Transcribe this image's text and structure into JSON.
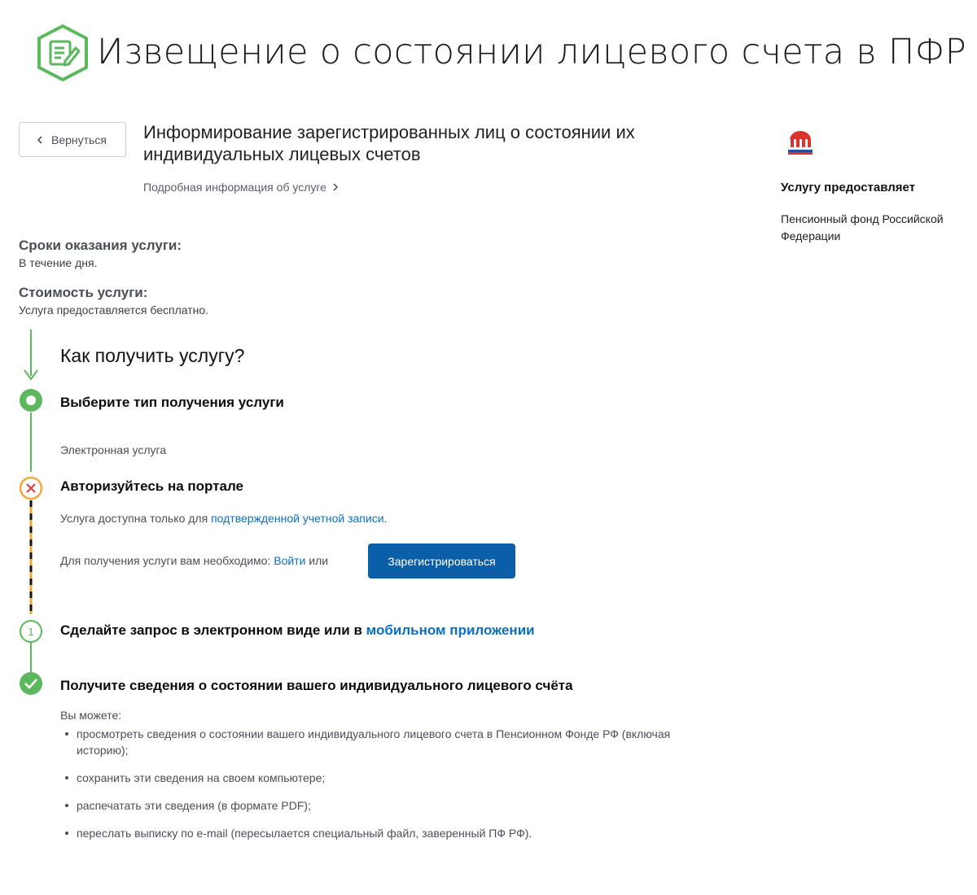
{
  "header": {
    "title": "Извещение о состоянии лицевого счета в ПФР",
    "icon": "document-edit-icon",
    "accent": "#5cb85c"
  },
  "service": {
    "back_label": "Вернуться",
    "title_bold": "Информирование зарегистрированных лиц о состоянии их индивидуальных лицевых счетов",
    "more_info": "Подробная информация об услуге"
  },
  "provider": {
    "heading": "Услугу предоставляет",
    "name": "Пенсионный фонд Российской Федерации",
    "logo": "pfr-logo-icon"
  },
  "meta": {
    "term_label": "Сроки оказания услуги:",
    "term_value": "В течение дня.",
    "cost_label": "Стоимость услуги:",
    "cost_value": "Услуга предоставляется бесплатно."
  },
  "how": {
    "title": "Как получить услугу?",
    "step1": {
      "title": "Выберите тип получения услуги",
      "value": "Электронная услуга"
    },
    "step2": {
      "title": "Авторизуйтесь на портале",
      "text_prefix": "Услуга доступна только для ",
      "text_link": "подтвержденной учетной записи",
      "text_suffix": ".",
      "need_prefix": "Для получения услуги вам необходимо: ",
      "login_link": "Войти",
      "need_or": " или",
      "register_button": "Зарегистрироваться"
    },
    "step3": {
      "number": "1",
      "title_prefix": "Сделайте запрос в электронном виде или в ",
      "title_link": "мобильном приложении"
    },
    "step4": {
      "title": "Получите сведения о состоянии вашего индивидуального лицевого счёта",
      "intro": "Вы можете:",
      "items": [
        "просмотреть сведения о состоянии вашего индивидуального лицевого счета в Пенсионном Фонде РФ (включая историю);",
        "сохранить эти сведения на своем компьютере;",
        "распечатать эти сведения (в формате PDF);",
        "переслать выписку по e-mail (пересылается специальный файл, заверенный ПФ РФ)."
      ]
    }
  },
  "colors": {
    "green": "#5cb85c",
    "warning": "#f2a93b",
    "error": "#d9434b",
    "link": "#0a6fc2",
    "button": "#0a5fa8"
  }
}
